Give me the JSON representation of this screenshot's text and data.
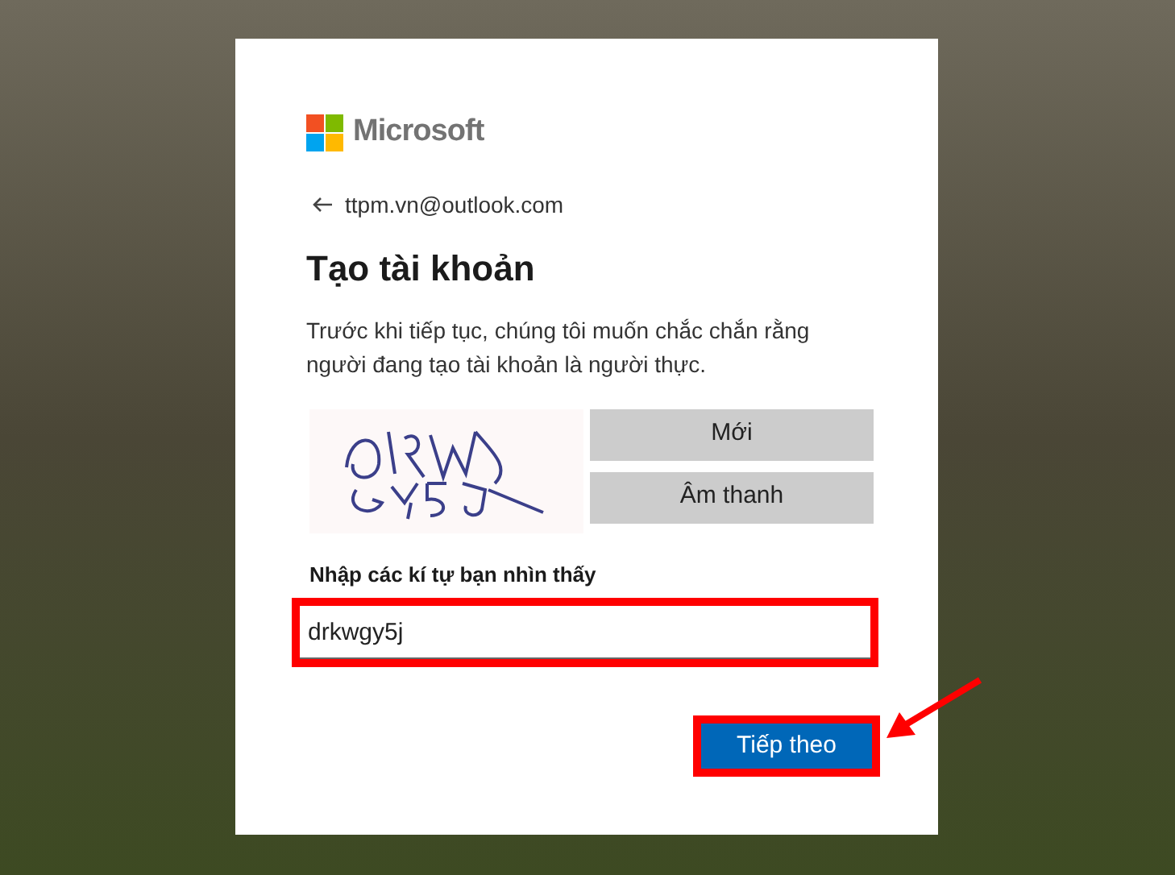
{
  "brand": {
    "name": "Microsoft"
  },
  "back": {
    "email": "ttpm.vn@outlook.com"
  },
  "title": "Tạo tài khoản",
  "description": "Trước khi tiếp tục, chúng tôi muốn chắc chắn rằng người đang tạo tài khoản là người thực.",
  "captcha": {
    "buttons": [
      "Mới",
      "Âm thanh"
    ]
  },
  "field": {
    "label": "Nhập các kí tự bạn nhìn thấy",
    "value": "drkwgy5j",
    "highlighted": true
  },
  "next_button": {
    "label": "Tiếp theo",
    "highlighted": true,
    "pointer_arrow": true
  }
}
